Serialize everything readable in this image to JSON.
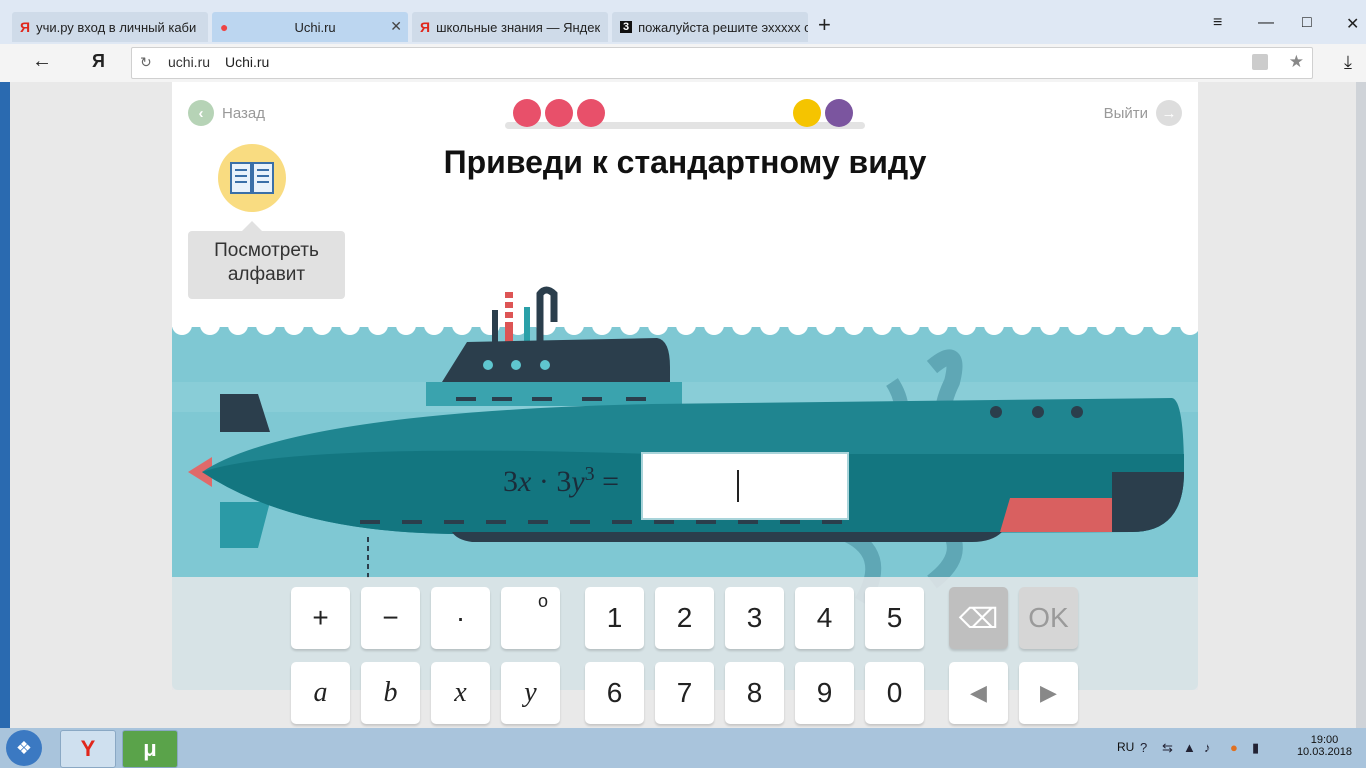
{
  "tabs": [
    {
      "icon": "Я",
      "label": "учи.ру вход в личный каби"
    },
    {
      "icon": "●",
      "label": "Uchi.ru"
    },
    {
      "icon": "Я",
      "label": "школьные знания — Яндек"
    },
    {
      "icon": "3",
      "label": "пожалуйста решите эхxxxx c"
    }
  ],
  "browser": {
    "new_tab": "+",
    "menu": "≡",
    "minimize": "—",
    "maximize": "□",
    "close": "✕",
    "back": "←",
    "ya": "Я",
    "reload": "↻",
    "domain": "uchi.ru",
    "page_title": "Uchi.ru",
    "download": "⤓"
  },
  "lesson": {
    "back_label": "Назад",
    "exit_label": "Выйти",
    "title": "Приведи к стандартному виду",
    "alphabet_tip": [
      "Посмотреть",
      "алфавит"
    ],
    "progress_dots": [
      "#e8506a",
      "#e8506a",
      "#e8506a",
      "#f5c400",
      "#7b559f"
    ],
    "expression": {
      "a": "3",
      "x": "x",
      "dot": "·",
      "b": "3",
      "y": "y",
      "exp": "3",
      "eq": "="
    },
    "answer_value": ""
  },
  "keyboard": {
    "row1": [
      "+",
      "−",
      "·",
      "o",
      "1",
      "2",
      "3",
      "4",
      "5"
    ],
    "row2": [
      "a",
      "b",
      "x",
      "y",
      "6",
      "7",
      "8",
      "9",
      "0"
    ],
    "backspace": "⌫",
    "ok": "OK",
    "left": "◀",
    "right": "▶"
  },
  "taskbar": {
    "start": "❖",
    "apps": [
      "Y",
      "μ"
    ],
    "lang": "RU",
    "time": "19:00",
    "date": "10.03.2018"
  },
  "colors": {
    "accent": "#1c7f8c",
    "sea": "#7fc8d3",
    "hull": "#1f8590"
  }
}
